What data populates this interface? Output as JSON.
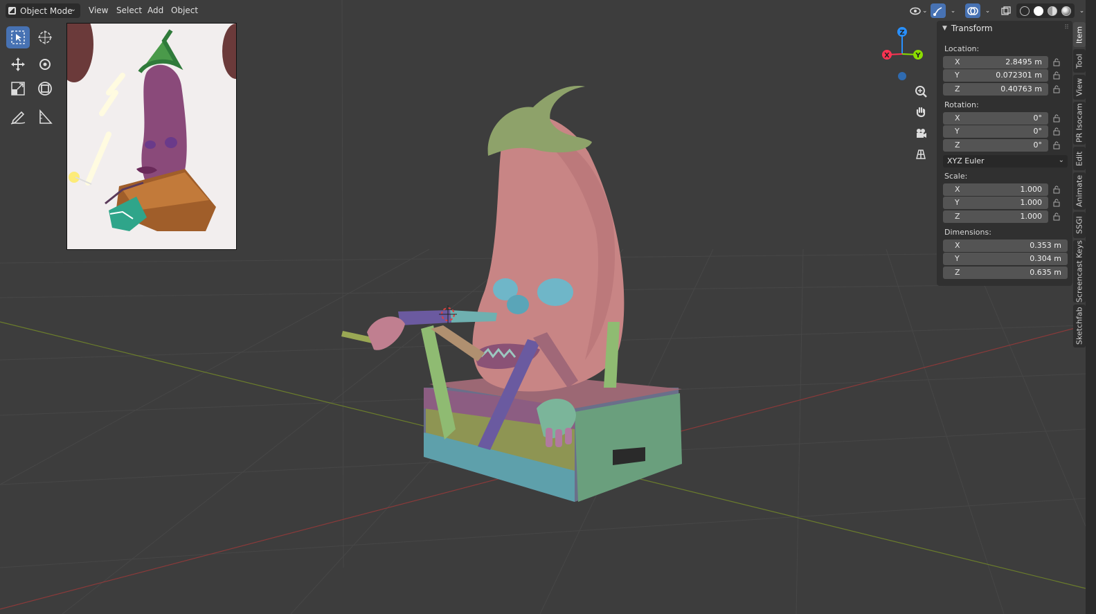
{
  "header": {
    "mode_label": "Object Mode",
    "menus": [
      "View",
      "Select",
      "Add",
      "Object"
    ]
  },
  "icons": {
    "tools": [
      "select-box-icon",
      "cursor-icon",
      "move-icon",
      "rotate-icon",
      "scale-icon",
      "transform-icon",
      "annotate-icon",
      "measure-icon"
    ],
    "nav": [
      "zoom-icon",
      "pan-hand-icon",
      "camera-icon",
      "grid-view-icon"
    ]
  },
  "gizmo": {
    "z": "Z",
    "y": "Y",
    "x": "X"
  },
  "panel": {
    "title": "Transform",
    "location_label": "Location:",
    "location": [
      {
        "axis": "X",
        "value": "2.8495 m"
      },
      {
        "axis": "Y",
        "value": "0.072301 m"
      },
      {
        "axis": "Z",
        "value": "0.40763 m"
      }
    ],
    "rotation_label": "Rotation:",
    "rotation": [
      {
        "axis": "X",
        "value": "0°"
      },
      {
        "axis": "Y",
        "value": "0°"
      },
      {
        "axis": "Z",
        "value": "0°"
      }
    ],
    "rotation_mode": "XYZ Euler",
    "scale_label": "Scale:",
    "scale": [
      {
        "axis": "X",
        "value": "1.000"
      },
      {
        "axis": "Y",
        "value": "1.000"
      },
      {
        "axis": "Z",
        "value": "1.000"
      }
    ],
    "dimensions_label": "Dimensions:",
    "dimensions": [
      {
        "axis": "X",
        "value": "0.353 m"
      },
      {
        "axis": "Y",
        "value": "0.304 m"
      },
      {
        "axis": "Z",
        "value": "0.635 m"
      }
    ]
  },
  "tabs": [
    "Item",
    "Tool",
    "View",
    "PR Isocam",
    "Edit",
    "Animate",
    "SSGI",
    "Screencast Keys",
    "Sketchfab"
  ],
  "colors": {
    "accent": "#4772b3",
    "axis_x": "#ff3352",
    "axis_y": "#8bdc00",
    "axis_z": "#2890ff"
  }
}
